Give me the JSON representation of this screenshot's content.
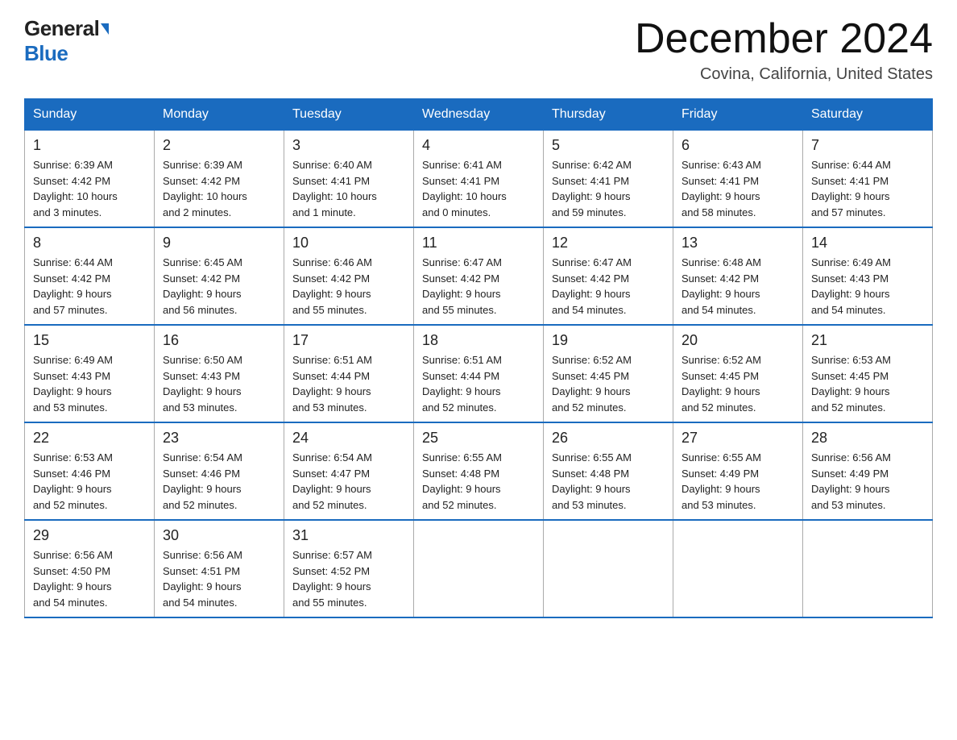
{
  "header": {
    "logo_general": "General",
    "logo_blue": "Blue",
    "month_title": "December 2024",
    "location": "Covina, California, United States"
  },
  "days_of_week": [
    "Sunday",
    "Monday",
    "Tuesday",
    "Wednesday",
    "Thursday",
    "Friday",
    "Saturday"
  ],
  "weeks": [
    [
      {
        "num": "1",
        "sunrise": "6:39 AM",
        "sunset": "4:42 PM",
        "daylight_hours": "10",
        "daylight_minutes": "3"
      },
      {
        "num": "2",
        "sunrise": "6:39 AM",
        "sunset": "4:42 PM",
        "daylight_hours": "10",
        "daylight_minutes": "2"
      },
      {
        "num": "3",
        "sunrise": "6:40 AM",
        "sunset": "4:41 PM",
        "daylight_hours": "10",
        "daylight_minutes": "1"
      },
      {
        "num": "4",
        "sunrise": "6:41 AM",
        "sunset": "4:41 PM",
        "daylight_hours": "10",
        "daylight_minutes": "0"
      },
      {
        "num": "5",
        "sunrise": "6:42 AM",
        "sunset": "4:41 PM",
        "daylight_hours": "9",
        "daylight_minutes": "59"
      },
      {
        "num": "6",
        "sunrise": "6:43 AM",
        "sunset": "4:41 PM",
        "daylight_hours": "9",
        "daylight_minutes": "58"
      },
      {
        "num": "7",
        "sunrise": "6:44 AM",
        "sunset": "4:41 PM",
        "daylight_hours": "9",
        "daylight_minutes": "57"
      }
    ],
    [
      {
        "num": "8",
        "sunrise": "6:44 AM",
        "sunset": "4:42 PM",
        "daylight_hours": "9",
        "daylight_minutes": "57"
      },
      {
        "num": "9",
        "sunrise": "6:45 AM",
        "sunset": "4:42 PM",
        "daylight_hours": "9",
        "daylight_minutes": "56"
      },
      {
        "num": "10",
        "sunrise": "6:46 AM",
        "sunset": "4:42 PM",
        "daylight_hours": "9",
        "daylight_minutes": "55"
      },
      {
        "num": "11",
        "sunrise": "6:47 AM",
        "sunset": "4:42 PM",
        "daylight_hours": "9",
        "daylight_minutes": "55"
      },
      {
        "num": "12",
        "sunrise": "6:47 AM",
        "sunset": "4:42 PM",
        "daylight_hours": "9",
        "daylight_minutes": "54"
      },
      {
        "num": "13",
        "sunrise": "6:48 AM",
        "sunset": "4:42 PM",
        "daylight_hours": "9",
        "daylight_minutes": "54"
      },
      {
        "num": "14",
        "sunrise": "6:49 AM",
        "sunset": "4:43 PM",
        "daylight_hours": "9",
        "daylight_minutes": "54"
      }
    ],
    [
      {
        "num": "15",
        "sunrise": "6:49 AM",
        "sunset": "4:43 PM",
        "daylight_hours": "9",
        "daylight_minutes": "53"
      },
      {
        "num": "16",
        "sunrise": "6:50 AM",
        "sunset": "4:43 PM",
        "daylight_hours": "9",
        "daylight_minutes": "53"
      },
      {
        "num": "17",
        "sunrise": "6:51 AM",
        "sunset": "4:44 PM",
        "daylight_hours": "9",
        "daylight_minutes": "53"
      },
      {
        "num": "18",
        "sunrise": "6:51 AM",
        "sunset": "4:44 PM",
        "daylight_hours": "9",
        "daylight_minutes": "52"
      },
      {
        "num": "19",
        "sunrise": "6:52 AM",
        "sunset": "4:45 PM",
        "daylight_hours": "9",
        "daylight_minutes": "52"
      },
      {
        "num": "20",
        "sunrise": "6:52 AM",
        "sunset": "4:45 PM",
        "daylight_hours": "9",
        "daylight_minutes": "52"
      },
      {
        "num": "21",
        "sunrise": "6:53 AM",
        "sunset": "4:45 PM",
        "daylight_hours": "9",
        "daylight_minutes": "52"
      }
    ],
    [
      {
        "num": "22",
        "sunrise": "6:53 AM",
        "sunset": "4:46 PM",
        "daylight_hours": "9",
        "daylight_minutes": "52"
      },
      {
        "num": "23",
        "sunrise": "6:54 AM",
        "sunset": "4:46 PM",
        "daylight_hours": "9",
        "daylight_minutes": "52"
      },
      {
        "num": "24",
        "sunrise": "6:54 AM",
        "sunset": "4:47 PM",
        "daylight_hours": "9",
        "daylight_minutes": "52"
      },
      {
        "num": "25",
        "sunrise": "6:55 AM",
        "sunset": "4:48 PM",
        "daylight_hours": "9",
        "daylight_minutes": "52"
      },
      {
        "num": "26",
        "sunrise": "6:55 AM",
        "sunset": "4:48 PM",
        "daylight_hours": "9",
        "daylight_minutes": "53"
      },
      {
        "num": "27",
        "sunrise": "6:55 AM",
        "sunset": "4:49 PM",
        "daylight_hours": "9",
        "daylight_minutes": "53"
      },
      {
        "num": "28",
        "sunrise": "6:56 AM",
        "sunset": "4:49 PM",
        "daylight_hours": "9",
        "daylight_minutes": "53"
      }
    ],
    [
      {
        "num": "29",
        "sunrise": "6:56 AM",
        "sunset": "4:50 PM",
        "daylight_hours": "9",
        "daylight_minutes": "54"
      },
      {
        "num": "30",
        "sunrise": "6:56 AM",
        "sunset": "4:51 PM",
        "daylight_hours": "9",
        "daylight_minutes": "54"
      },
      {
        "num": "31",
        "sunrise": "6:57 AM",
        "sunset": "4:52 PM",
        "daylight_hours": "9",
        "daylight_minutes": "55"
      },
      null,
      null,
      null,
      null
    ]
  ]
}
